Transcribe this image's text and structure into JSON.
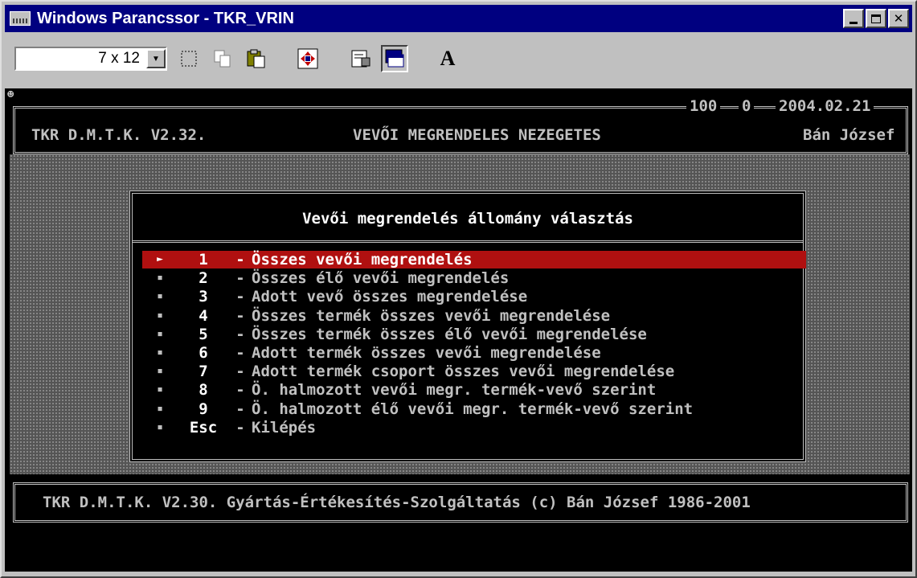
{
  "window": {
    "title": "Windows Parancssor - TKR_VRIN",
    "controls": [
      "minimize-icon",
      "maximize-icon",
      "close-icon"
    ]
  },
  "toolbar": {
    "font_size": "7 x 12",
    "buttons": [
      "mark-icon",
      "copy-icon",
      "paste-icon",
      "fullscreen-icon",
      "properties-icon",
      "background-icon",
      "font-icon"
    ],
    "font_button_label": "A"
  },
  "header": {
    "app": "TKR D.M.T.K. V2.32.",
    "screen_title": "VEVŐI MEGRENDELES NEZEGETES",
    "counter_a": "100",
    "counter_b": "0",
    "date": "2004.02.21",
    "user": "Bán József"
  },
  "dialog": {
    "title": "Vevői megrendelés állomány választás",
    "options": [
      {
        "key": "1",
        "label": "Összes vevői megrendelés",
        "selected": true
      },
      {
        "key": "2",
        "label": "Összes élő vevői megrendelés"
      },
      {
        "key": "3",
        "label": "Adott vevő összes megrendelése"
      },
      {
        "key": "4",
        "label": "Összes termék összes vevői megrendelése"
      },
      {
        "key": "5",
        "label": "Összes termék összes élő vevői megrendelése"
      },
      {
        "key": "6",
        "label": "Adott termék összes vevői megrendelése"
      },
      {
        "key": "7",
        "label": "Adott termék csoport összes vevői megrendelése"
      },
      {
        "key": "8",
        "label": "Ö. halmozott vevői megr. termék-vevő szerint"
      },
      {
        "key": "9",
        "label": "Ö. halmozott élő vevői megr. termék-vevő szerint"
      },
      {
        "key": "Esc",
        "label": "Kilépés"
      }
    ],
    "dash": "-",
    "bullet": "▪",
    "pointer": "►"
  },
  "footer": {
    "text": "TKR D.M.T.K. V2.30. Gyártás-Értékesítés-Szolgáltatás (c) Bán József 1986-2001"
  },
  "colors": {
    "titlebar": "#000080",
    "selection": "#b01010",
    "console_fg": "#c0c0c0"
  }
}
